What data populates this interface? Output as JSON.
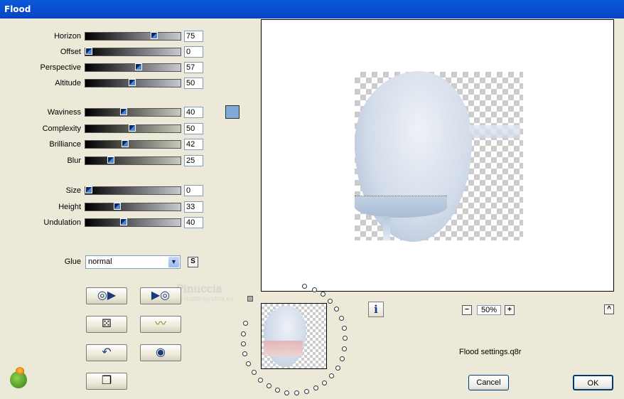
{
  "window": {
    "title": "Flood"
  },
  "sliders_group1": [
    {
      "label": "Horizon",
      "value": "75",
      "level": 75
    },
    {
      "label": "Offset",
      "value": "0",
      "level": 0
    },
    {
      "label": "Perspective",
      "value": "57",
      "level": 57
    },
    {
      "label": "Altitude",
      "value": "50",
      "level": 50
    }
  ],
  "sliders_group2": [
    {
      "label": "Waviness",
      "value": "40",
      "level": 40
    },
    {
      "label": "Complexity",
      "value": "50",
      "level": 50
    },
    {
      "label": "Brilliance",
      "value": "42",
      "level": 42
    },
    {
      "label": "Blur",
      "value": "25",
      "level": 25
    }
  ],
  "sliders_group3": [
    {
      "label": "Size",
      "value": "0",
      "level": 0
    },
    {
      "label": "Height",
      "value": "33",
      "level": 33
    },
    {
      "label": "Undulation",
      "value": "40",
      "level": 40
    }
  ],
  "color_swatch": "#7fa9d7",
  "glue": {
    "label": "Glue",
    "value": "normal",
    "s_button": "S"
  },
  "watermark": {
    "name": "Pinuccia",
    "site": "www.maidiregrafica.eu"
  },
  "zoom": {
    "minus": "−",
    "value": "50%",
    "plus": "+"
  },
  "info_button": "i",
  "scroll_up_button": "^",
  "settings_file": "Flood settings.q8r",
  "buttons": {
    "cancel": "Cancel",
    "ok": "OK"
  }
}
